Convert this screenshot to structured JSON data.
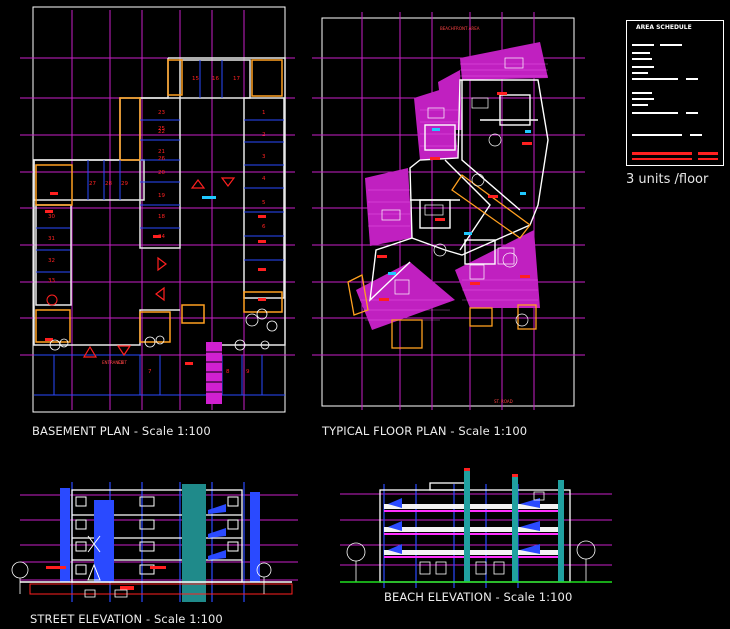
{
  "captions": {
    "basement": "BASEMENT PLAN - Scale 1:100",
    "typical": "TYPICAL FLOOR PLAN - Scale 1:100",
    "street": "STREET ELEVATION - Scale 1:100",
    "beach": "BEACH ELEVATION - Scale 1:100"
  },
  "schedule": {
    "title": "AREA SCHEDULE",
    "units_note": "3 units /floor"
  },
  "basement": {
    "top_right_stalls": [
      "15",
      "16",
      "17"
    ],
    "left_column_stalls": [
      "23",
      "22",
      "21",
      "20",
      "19",
      "18"
    ],
    "row_stalls": [
      "27",
      "28",
      "29"
    ],
    "center_stalls": [
      "24",
      "25",
      "26"
    ],
    "right_column_stalls": [
      "1",
      "2",
      "3",
      "4",
      "5",
      "6"
    ],
    "bottom_stalls": [
      "7",
      "8",
      "9"
    ],
    "left_lower_stalls": [
      "30",
      "31",
      "32",
      "33"
    ],
    "entrance_label": "ENTRANCE",
    "exit_label": "EXIT"
  },
  "colors": {
    "background": "#000000",
    "grid": "#c81fc8",
    "wall": "#e8e8e8",
    "accent_magenta": "#ff30ff",
    "accent_red": "#ff2020",
    "accent_orange": "#ffa020",
    "accent_blue": "#2a4aff",
    "accent_cyan": "#20c8ff",
    "accent_green": "#20e020"
  }
}
